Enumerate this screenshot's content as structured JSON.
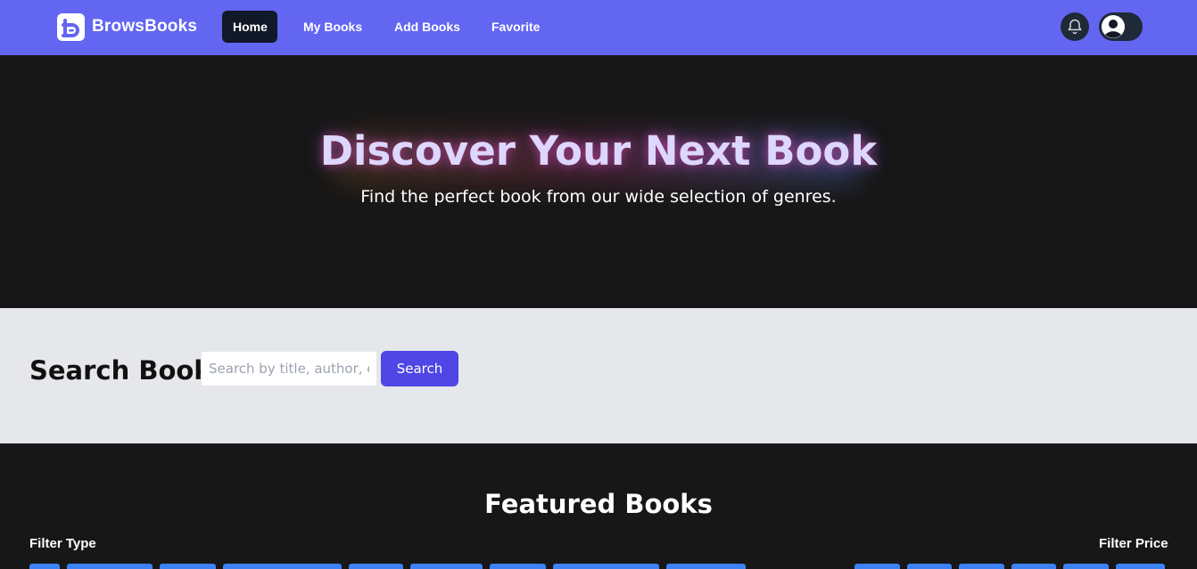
{
  "navbar": {
    "brand": "BrowsBooks",
    "links": [
      {
        "label": "Home",
        "active": true
      },
      {
        "label": "My Books",
        "active": false
      },
      {
        "label": "Add Books",
        "active": false
      },
      {
        "label": "Favorite",
        "active": false
      }
    ],
    "icons": [
      "bell-icon",
      "user-avatar-icon"
    ]
  },
  "hero": {
    "title": "Discover Your Next Book",
    "subtitle": "Find the perfect book from our wide selection of genres."
  },
  "search": {
    "heading": "Search Books",
    "placeholder": "Search by title, author, etc",
    "button_label": "Search"
  },
  "featured": {
    "title": "Featured Books",
    "filter_type_label": "Filter Type",
    "filter_price_label": "Filter Price"
  },
  "colors": {
    "navbar": "#6366f1",
    "active_link": "#111827",
    "hero_title": "#ddd6fe",
    "search_button": "#4f46e5",
    "filter_chip": "#3b82f6",
    "dark_bg": "#171717",
    "light_bg": "#e5e7eb"
  }
}
